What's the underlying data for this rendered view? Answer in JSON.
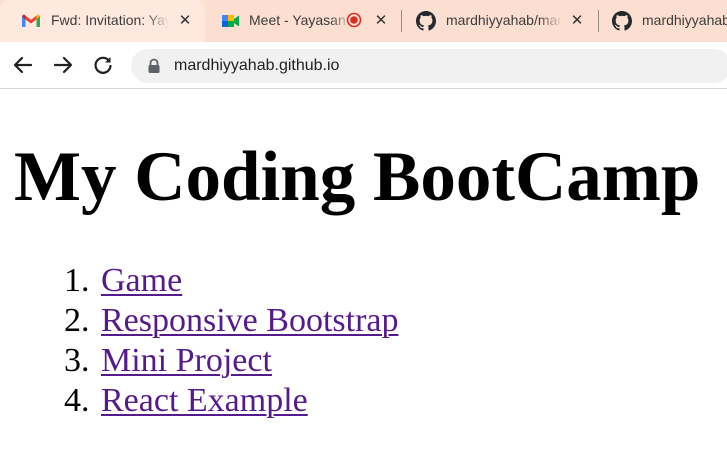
{
  "browser": {
    "tabs": [
      {
        "title": "Fwd: Invitation: Yayasan",
        "icon": "gmail-icon",
        "active": true
      },
      {
        "title": "Meet - Yayasan",
        "icon": "google-meet-icon",
        "recording": true,
        "active": false
      },
      {
        "title": "mardhiyyahab/mardhiyyahab",
        "icon": "github-icon",
        "active": false
      },
      {
        "title": "mardhiyyahab",
        "icon": "github-icon",
        "active": false
      }
    ],
    "url": "mardhiyyahab.github.io",
    "colors": {
      "tabstrip": "#fddfd1",
      "active_tab": "#ffe9df",
      "recording": "#d93025"
    }
  },
  "page": {
    "heading": "My Coding BootCamp",
    "links": [
      {
        "number": "1.",
        "label": "Game"
      },
      {
        "number": "2.",
        "label": "Responsive Bootstrap"
      },
      {
        "number": "3.",
        "label": "Mini Project"
      },
      {
        "number": "4.",
        "label": "React Example"
      }
    ],
    "link_color": "#551a8b"
  }
}
